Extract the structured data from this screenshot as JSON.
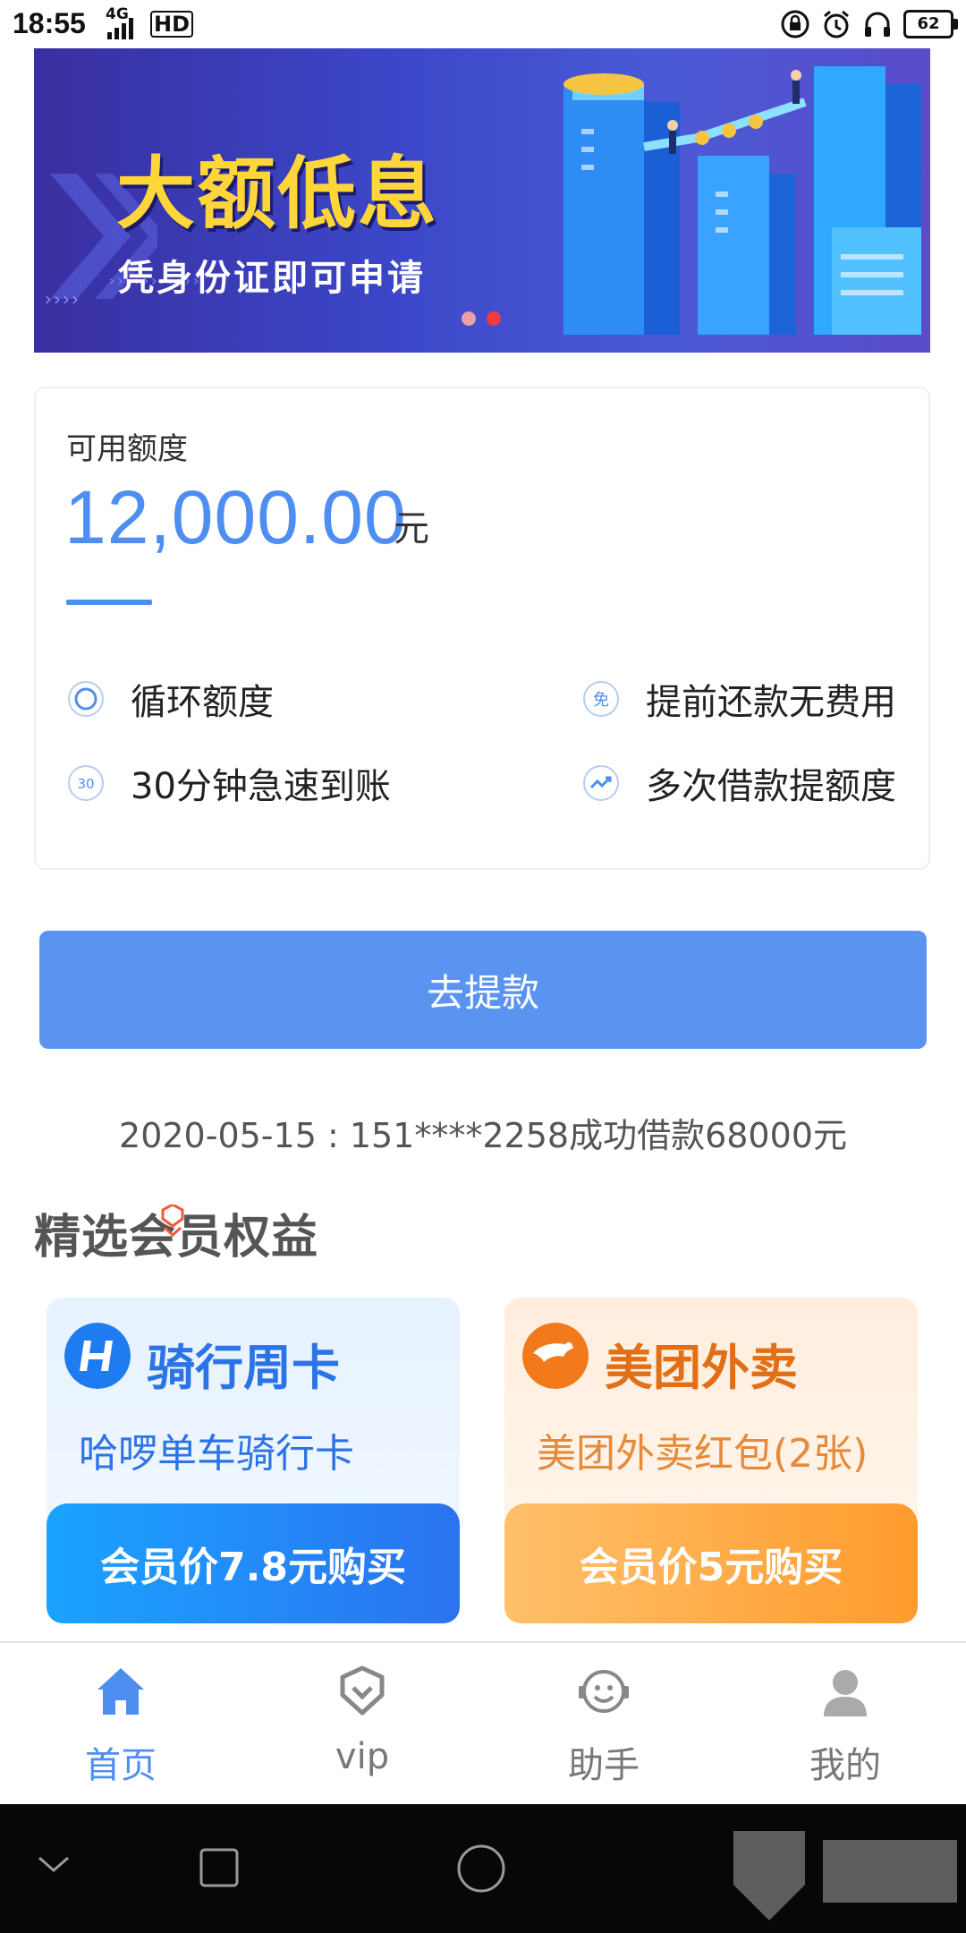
{
  "status_bar": {
    "time": "18:55",
    "network": "4G",
    "hd": "HD",
    "battery": "62"
  },
  "banner": {
    "title": "大额低息",
    "subtitle": "凭身份证即可申请",
    "slide_count": 2,
    "active_slide": 2
  },
  "credit": {
    "label": "可用额度",
    "amount": "12,000.00",
    "unit": "元",
    "features": [
      {
        "icon": "cycle-icon",
        "text": "循环额度"
      },
      {
        "icon": "free-icon",
        "text": "提前还款无费用"
      },
      {
        "icon": "thirty-min-icon",
        "text": "30分钟急速到账"
      },
      {
        "icon": "growth-icon",
        "text": "多次借款提额度"
      }
    ]
  },
  "withdraw_button": "去提款",
  "notice": "2020-05-15 : 151****2258成功借款68000元",
  "section_title": "精选会员权益",
  "benefits": [
    {
      "title": "骑行周卡",
      "subtitle": "哈啰单车骑行卡",
      "button": "会员价7.8元购买",
      "icon": "hellobike-logo-icon"
    },
    {
      "title": "美团外卖",
      "subtitle": "美团外卖红包(2张)",
      "button": "会员价5元购买",
      "icon": "meituan-kangaroo-icon"
    }
  ],
  "bottom_nav": [
    {
      "label": "首页",
      "icon": "home-icon",
      "active": true
    },
    {
      "label": "vip",
      "icon": "vip-heart-icon",
      "active": false
    },
    {
      "label": "助手",
      "icon": "assistant-icon",
      "active": false
    },
    {
      "label": "我的",
      "icon": "profile-icon",
      "active": false
    }
  ],
  "colors": {
    "accent": "#4e8ef0",
    "button": "#5b93f1",
    "banner_title": "#ffd63a"
  }
}
